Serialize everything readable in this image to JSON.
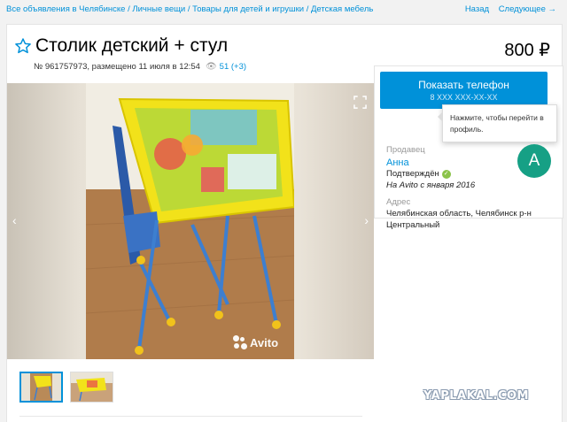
{
  "breadcrumbs": [
    "Все объявления в Челябинске",
    "Личные вещи",
    "Товары для детей и игрушки",
    "Детская мебель"
  ],
  "breadcrumb_separator": " / ",
  "nav": {
    "prev": "Назад",
    "next": "Следующее →"
  },
  "listing": {
    "title": "Столик детский + стул",
    "price": "800 ₽",
    "id_posted": "№ 961757973, размещено 11 июля в 12:54",
    "views": "51 (+3)"
  },
  "gallery": {
    "watermark": "Avito",
    "prev_arrow": "‹",
    "next_arrow": "›",
    "thumbnail_count": 2,
    "active_thumbnail": 1
  },
  "sidebar": {
    "show_button": "Показать телефон",
    "show_button_sub": "8 XXX XXX-XX-XX",
    "tooltip": "Нажмите, чтобы перейти в профиль.",
    "seller_label": "Продавец",
    "seller_name": "Анна",
    "verified": "Подтверждён",
    "since": "На Avito с января 2016",
    "avatar_letter": "А",
    "address_label": "Адрес",
    "address_line1": "Челябинская область, Челябинск р-н",
    "address_line2": "Центральный"
  },
  "site_watermark": "YAPLAKAL.COM",
  "colors": {
    "accent": "#0091d9",
    "avatar": "#16a085",
    "verified": "#8bc34a"
  }
}
